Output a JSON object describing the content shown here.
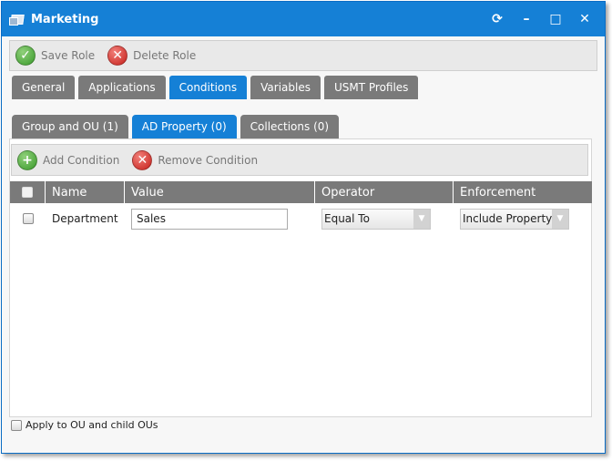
{
  "window": {
    "title": "Marketing",
    "controls": {
      "refresh": "⟳",
      "minimize": "–",
      "maximize": "□",
      "close": "✕"
    }
  },
  "toolbar": {
    "save_label": "Save Role",
    "delete_label": "Delete Role"
  },
  "main_tabs": [
    {
      "label": "General",
      "active": false
    },
    {
      "label": "Applications",
      "active": false
    },
    {
      "label": "Conditions",
      "active": true
    },
    {
      "label": "Variables",
      "active": false
    },
    {
      "label": "USMT Profiles",
      "active": false
    }
  ],
  "sub_tabs": [
    {
      "label": "Group and OU (1)",
      "active": false
    },
    {
      "label": "AD Property (0)",
      "active": true
    },
    {
      "label": "Collections (0)",
      "active": false
    }
  ],
  "conditions_toolbar": {
    "add_label": "Add Condition",
    "remove_label": "Remove Condition"
  },
  "grid": {
    "columns": [
      "Name",
      "Value",
      "Operator",
      "Enforcement"
    ],
    "rows": [
      {
        "name": "Department",
        "value": "Sales",
        "operator": "Equal To",
        "enforcement": "Include Property",
        "checked": false
      }
    ]
  },
  "footer": {
    "apply_label": "Apply to OU and child OUs",
    "checked": false
  },
  "colors": {
    "accent": "#1580d6",
    "tab_inactive": "#7a7a7a",
    "header_bg": "#7a7a7a"
  }
}
